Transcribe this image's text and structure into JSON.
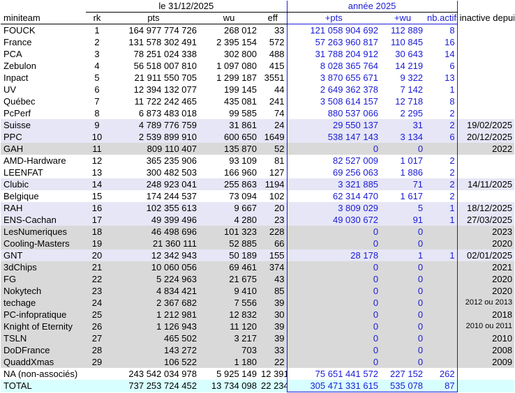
{
  "header": {
    "date_label": "le 31/12/2025",
    "year_label": "année 2025",
    "columns": {
      "team": "miniteam",
      "rk": "rk",
      "pts": "pts",
      "wu": "wu",
      "eff": "eff",
      "plus_pts": "+pts",
      "plus_wu": "+wu",
      "nb_actifs": "nb.actifs",
      "inactive": "inactive depuis"
    }
  },
  "rows": [
    {
      "team": "FOUCK",
      "rk": "1",
      "pts": "164 977 774 726",
      "wu": "268 012",
      "eff": "33",
      "plus_pts": "121 058 904 692",
      "plus_wu": "112 889",
      "nb_actifs": "8",
      "inactive": "",
      "style": "white"
    },
    {
      "team": "France",
      "rk": "2",
      "pts": "131 578 302 491",
      "wu": "2 395 154",
      "eff": "572",
      "plus_pts": "57 263 960 817",
      "plus_wu": "110 845",
      "nb_actifs": "16",
      "inactive": "",
      "style": "white"
    },
    {
      "team": "PCA",
      "rk": "3",
      "pts": "78 251 024 338",
      "wu": "302 800",
      "eff": "488",
      "plus_pts": "31 788 204 912",
      "plus_wu": "30 643",
      "nb_actifs": "14",
      "inactive": "",
      "style": "white"
    },
    {
      "team": "Zebulon",
      "rk": "4",
      "pts": "56 518 007 810",
      "wu": "1 097 080",
      "eff": "415",
      "plus_pts": "8 028 365 764",
      "plus_wu": "14 219",
      "nb_actifs": "6",
      "inactive": "",
      "style": "white"
    },
    {
      "team": "Inpact",
      "rk": "5",
      "pts": "21 911 550 705",
      "wu": "1 299 187",
      "eff": "3551",
      "plus_pts": "3 870 655 671",
      "plus_wu": "9 322",
      "nb_actifs": "13",
      "inactive": "",
      "style": "white"
    },
    {
      "team": "UV",
      "rk": "6",
      "pts": "12 394 132 077",
      "wu": "199 145",
      "eff": "44",
      "plus_pts": "2 649 362 378",
      "plus_wu": "7 142",
      "nb_actifs": "1",
      "inactive": "",
      "style": "white"
    },
    {
      "team": "Québec",
      "rk": "7",
      "pts": "11 722 242 465",
      "wu": "435 081",
      "eff": "241",
      "plus_pts": "3 508 614 157",
      "plus_wu": "12 718",
      "nb_actifs": "8",
      "inactive": "",
      "style": "white"
    },
    {
      "team": "PcPerf",
      "rk": "8",
      "pts": "6 873 483 018",
      "wu": "99 585",
      "eff": "74",
      "plus_pts": "880 537 066",
      "plus_wu": "2 295",
      "nb_actifs": "2",
      "inactive": "",
      "style": "white"
    },
    {
      "team": "Suisse",
      "rk": "9",
      "pts": "4 789 776 759",
      "wu": "31 861",
      "eff": "24",
      "plus_pts": "29 550 137",
      "plus_wu": "31",
      "nb_actifs": "2",
      "inactive": "19/02/2025",
      "style": "band"
    },
    {
      "team": "PPC",
      "rk": "10",
      "pts": "2 539 899 910",
      "wu": "600 650",
      "eff": "1649",
      "plus_pts": "538 147 143",
      "plus_wu": "3 134",
      "nb_actifs": "6",
      "inactive": "20/12/2025",
      "style": "band"
    },
    {
      "team": "GAH",
      "rk": "11",
      "pts": "809 110 407",
      "wu": "135 870",
      "eff": "52",
      "plus_pts": "0",
      "plus_wu": "0",
      "nb_actifs": "",
      "inactive": "2022",
      "style": "grey"
    },
    {
      "team": "AMD-Hardware",
      "rk": "12",
      "pts": "365 235 906",
      "wu": "93 109",
      "eff": "81",
      "plus_pts": "82 527 009",
      "plus_wu": "1 017",
      "nb_actifs": "2",
      "inactive": "",
      "style": "white"
    },
    {
      "team": "LEENFAT",
      "rk": "13",
      "pts": "300 482 503",
      "wu": "166 960",
      "eff": "127",
      "plus_pts": "69 256 063",
      "plus_wu": "1 886",
      "nb_actifs": "2",
      "inactive": "",
      "style": "white"
    },
    {
      "team": "Clubic",
      "rk": "14",
      "pts": "248 923 041",
      "wu": "255 863",
      "eff": "1194",
      "plus_pts": "3 321 885",
      "plus_wu": "71",
      "nb_actifs": "2",
      "inactive": "14/11/2025",
      "style": "band"
    },
    {
      "team": "Belgique",
      "rk": "15",
      "pts": "174 244 537",
      "wu": "73 094",
      "eff": "102",
      "plus_pts": "62 314 470",
      "plus_wu": "1 617",
      "nb_actifs": "2",
      "inactive": "",
      "style": "white"
    },
    {
      "team": "RAH",
      "rk": "16",
      "pts": "102 355 613",
      "wu": "9 667",
      "eff": "20",
      "plus_pts": "3 809 029",
      "plus_wu": "5",
      "nb_actifs": "1",
      "inactive": "18/12/2025",
      "style": "band"
    },
    {
      "team": "ENS-Cachan",
      "rk": "17",
      "pts": "49 399 496",
      "wu": "4 280",
      "eff": "23",
      "plus_pts": "49 030 672",
      "plus_wu": "91",
      "nb_actifs": "1",
      "inactive": "27/03/2025",
      "style": "band"
    },
    {
      "team": "LesNumeriques",
      "rk": "18",
      "pts": "46 498 696",
      "wu": "101 323",
      "eff": "228",
      "plus_pts": "0",
      "plus_wu": "0",
      "nb_actifs": "",
      "inactive": "2023",
      "style": "grey"
    },
    {
      "team": "Cooling-Masters",
      "rk": "19",
      "pts": "21 360 111",
      "wu": "52 885",
      "eff": "66",
      "plus_pts": "0",
      "plus_wu": "0",
      "nb_actifs": "",
      "inactive": "2020",
      "style": "grey"
    },
    {
      "team": "GNT",
      "rk": "20",
      "pts": "12 342 943",
      "wu": "50 189",
      "eff": "155",
      "plus_pts": "28 178",
      "plus_wu": "1",
      "nb_actifs": "1",
      "inactive": "02/01/2025",
      "style": "band"
    },
    {
      "team": "3dChips",
      "rk": "21",
      "pts": "10 060 056",
      "wu": "69 461",
      "eff": "374",
      "plus_pts": "0",
      "plus_wu": "0",
      "nb_actifs": "",
      "inactive": "2021",
      "style": "grey"
    },
    {
      "team": "FG",
      "rk": "22",
      "pts": "5 224 963",
      "wu": "21 675",
      "eff": "43",
      "plus_pts": "0",
      "plus_wu": "0",
      "nb_actifs": "",
      "inactive": "2020",
      "style": "grey"
    },
    {
      "team": "Nokytech",
      "rk": "23",
      "pts": "4 834 421",
      "wu": "9 410",
      "eff": "85",
      "plus_pts": "0",
      "plus_wu": "0",
      "nb_actifs": "",
      "inactive": "2020",
      "style": "grey"
    },
    {
      "team": "techage",
      "rk": "24",
      "pts": "2 367 682",
      "wu": "7 556",
      "eff": "39",
      "plus_pts": "0",
      "plus_wu": "0",
      "nb_actifs": "",
      "inactive": "2012 ou 2013",
      "inactive_small": true,
      "style": "grey"
    },
    {
      "team": "PC-infopratique",
      "rk": "25",
      "pts": "1 212 981",
      "wu": "12 832",
      "eff": "30",
      "plus_pts": "0",
      "plus_wu": "0",
      "nb_actifs": "",
      "inactive": "2018",
      "style": "grey"
    },
    {
      "team": "Knight of Eternity",
      "rk": "26",
      "pts": "1 126 943",
      "wu": "11 120",
      "eff": "39",
      "plus_pts": "0",
      "plus_wu": "0",
      "nb_actifs": "",
      "inactive": "2010 ou 2011",
      "inactive_small": true,
      "style": "grey"
    },
    {
      "team": "TSLN",
      "rk": "27",
      "pts": "465 502",
      "wu": "3 217",
      "eff": "39",
      "plus_pts": "0",
      "plus_wu": "0",
      "nb_actifs": "",
      "inactive": "2010",
      "style": "grey"
    },
    {
      "team": "DoDFrance",
      "rk": "28",
      "pts": "143 272",
      "wu": "703",
      "eff": "33",
      "plus_pts": "0",
      "plus_wu": "0",
      "nb_actifs": "",
      "inactive": "2008",
      "style": "grey"
    },
    {
      "team": "QuaddXmas",
      "rk": "29",
      "pts": "106 522",
      "wu": "1 180",
      "eff": "22",
      "plus_pts": "0",
      "plus_wu": "0",
      "nb_actifs": "",
      "inactive": "2009",
      "style": "grey"
    }
  ],
  "na_row": {
    "team": "NA (non-associés)",
    "pts": "243 542 034 978",
    "wu": "5 925 149",
    "eff": "12 391",
    "plus_pts": "75 651 441 572",
    "plus_wu": "227 152",
    "nb_actifs": "262"
  },
  "total_row": {
    "team": "TOTAL",
    "pts": "737 253 724 452",
    "wu": "13 734 098",
    "eff": "22 234",
    "plus_pts": "305 471 331 615",
    "plus_wu": "535 078",
    "nb_actifs": "87"
  },
  "colors": {
    "blue_text": "#1b1bd6",
    "band": "#e6e6f6",
    "grey": "#d9d9d9",
    "cyan": "#d8ffff"
  }
}
